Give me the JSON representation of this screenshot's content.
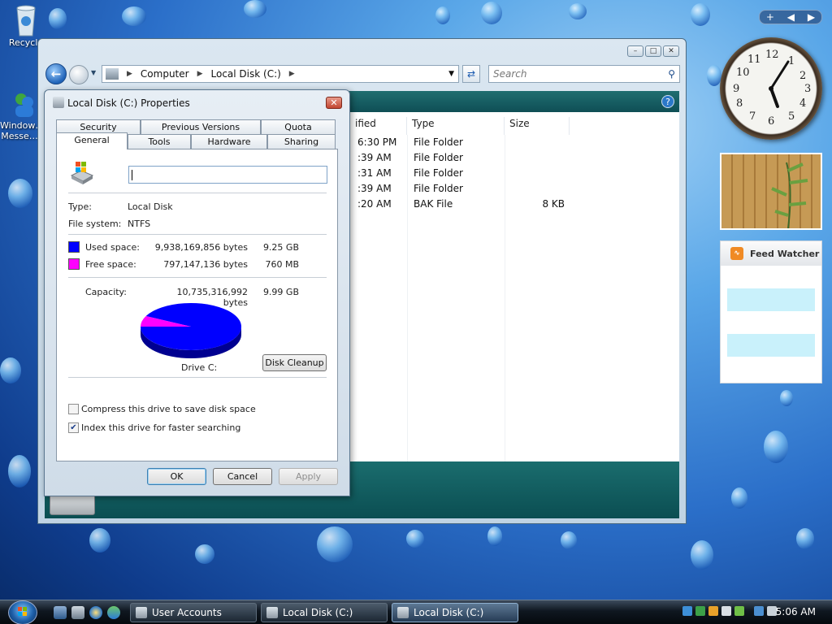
{
  "desktop": {
    "icons": [
      {
        "label": "Recycle",
        "icon": "recycle-bin-icon"
      },
      {
        "label": "Window… Messe…",
        "icon": "windows-messenger-icon"
      }
    ]
  },
  "explorer": {
    "breadcrumb": [
      "Computer",
      "Local Disk (C:)"
    ],
    "search_placeholder": "Search",
    "columns": [
      "ified",
      "Type",
      "Size"
    ],
    "rows": [
      {
        "modified": "6:30 PM",
        "type": "File Folder",
        "size": ""
      },
      {
        "modified": ":39 AM",
        "type": "File Folder",
        "size": ""
      },
      {
        "modified": ":31 AM",
        "type": "File Folder",
        "size": ""
      },
      {
        "modified": ":39 AM",
        "type": "File Folder",
        "size": ""
      },
      {
        "modified": ":20 AM",
        "type": "BAK File",
        "size": "8 KB"
      }
    ],
    "caption_buttons": [
      "minimize-icon",
      "maximize-icon",
      "close-icon"
    ]
  },
  "dialog": {
    "title": "Local Disk (C:) Properties",
    "tabs_back": [
      "Security",
      "Previous Versions",
      "Quota"
    ],
    "tabs_front": [
      "General",
      "Tools",
      "Hardware",
      "Sharing"
    ],
    "active_tab": "General",
    "name_value": "",
    "type_label": "Type:",
    "type_value": "Local Disk",
    "fs_label": "File system:",
    "fs_value": "NTFS",
    "used_label": "Used space:",
    "used_bytes": "9,938,169,856 bytes",
    "used_gb": "9.25 GB",
    "free_label": "Free space:",
    "free_bytes": "797,147,136 bytes",
    "free_mb": "760 MB",
    "capacity_label": "Capacity:",
    "capacity_bytes": "10,735,316,992 bytes",
    "capacity_gb": "9.99 GB",
    "drive_label": "Drive C:",
    "cleanup_label": "Disk Cleanup",
    "compress_label": "Compress this drive to save disk space",
    "compress_checked": false,
    "index_label": "Index this drive for faster searching",
    "index_checked": true,
    "ok_label": "OK",
    "cancel_label": "Cancel",
    "apply_label": "Apply",
    "used_fraction": 0.9257,
    "colors": {
      "used": "#0000ff",
      "free": "#ff00ff"
    }
  },
  "gadgets": {
    "clock_numbers": [
      "12",
      "1",
      "2",
      "3",
      "4",
      "5",
      "6",
      "7",
      "8",
      "9",
      "10",
      "11"
    ],
    "feed_title": "Feed Watcher"
  },
  "taskbar": {
    "tasks": [
      {
        "label": "User Accounts",
        "active": false
      },
      {
        "label": "Local Disk (C:)",
        "active": false
      },
      {
        "label": "Local Disk (C:) Prop…",
        "active": true
      }
    ],
    "time": "5:06 AM"
  }
}
